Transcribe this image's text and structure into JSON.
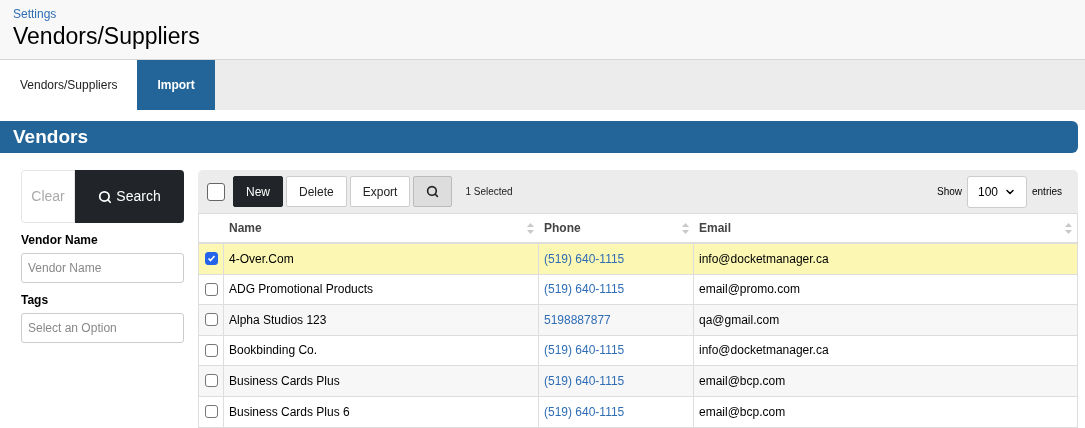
{
  "breadcrumb": "Settings",
  "title": "Vendors/Suppliers",
  "tabs": [
    {
      "label": "Vendors/Suppliers",
      "selected": true
    },
    {
      "label": "Import",
      "selected": false
    }
  ],
  "section_title": "Vendors",
  "filters": {
    "clear": "Clear",
    "search": "Search",
    "fields": [
      {
        "label": "Vendor Name",
        "placeholder": "Vendor Name"
      },
      {
        "label": "Tags",
        "placeholder": "Select an Option"
      }
    ]
  },
  "toolbar": {
    "select_all": false,
    "buttons": [
      "New",
      "Delete",
      "Export"
    ],
    "selected_count": "1 Selected",
    "show": "Show",
    "page_size": "100",
    "entries": "entries"
  },
  "table": {
    "columns": [
      "Name",
      "Phone",
      "Email"
    ],
    "rows": [
      {
        "selected": true,
        "name": "4-Over.Com",
        "phone": "(519) 640-1115",
        "email": "info@docketmanager.ca"
      },
      {
        "selected": false,
        "name": "ADG Promotional Products",
        "phone": "(519) 640-1115",
        "email": "email@promo.com"
      },
      {
        "selected": false,
        "name": "Alpha Studios 123",
        "phone": "5198887877",
        "email": "qa@gmail.com"
      },
      {
        "selected": false,
        "name": "Bookbinding Co.",
        "phone": "(519) 640-1115",
        "email": "info@docketmanager.ca"
      },
      {
        "selected": false,
        "name": "Business Cards Plus",
        "phone": "(519) 640-1115",
        "email": "email@bcp.com"
      },
      {
        "selected": false,
        "name": "Business Cards Plus 6",
        "phone": "(519) 640-1115",
        "email": "email@bcp.com"
      }
    ]
  }
}
